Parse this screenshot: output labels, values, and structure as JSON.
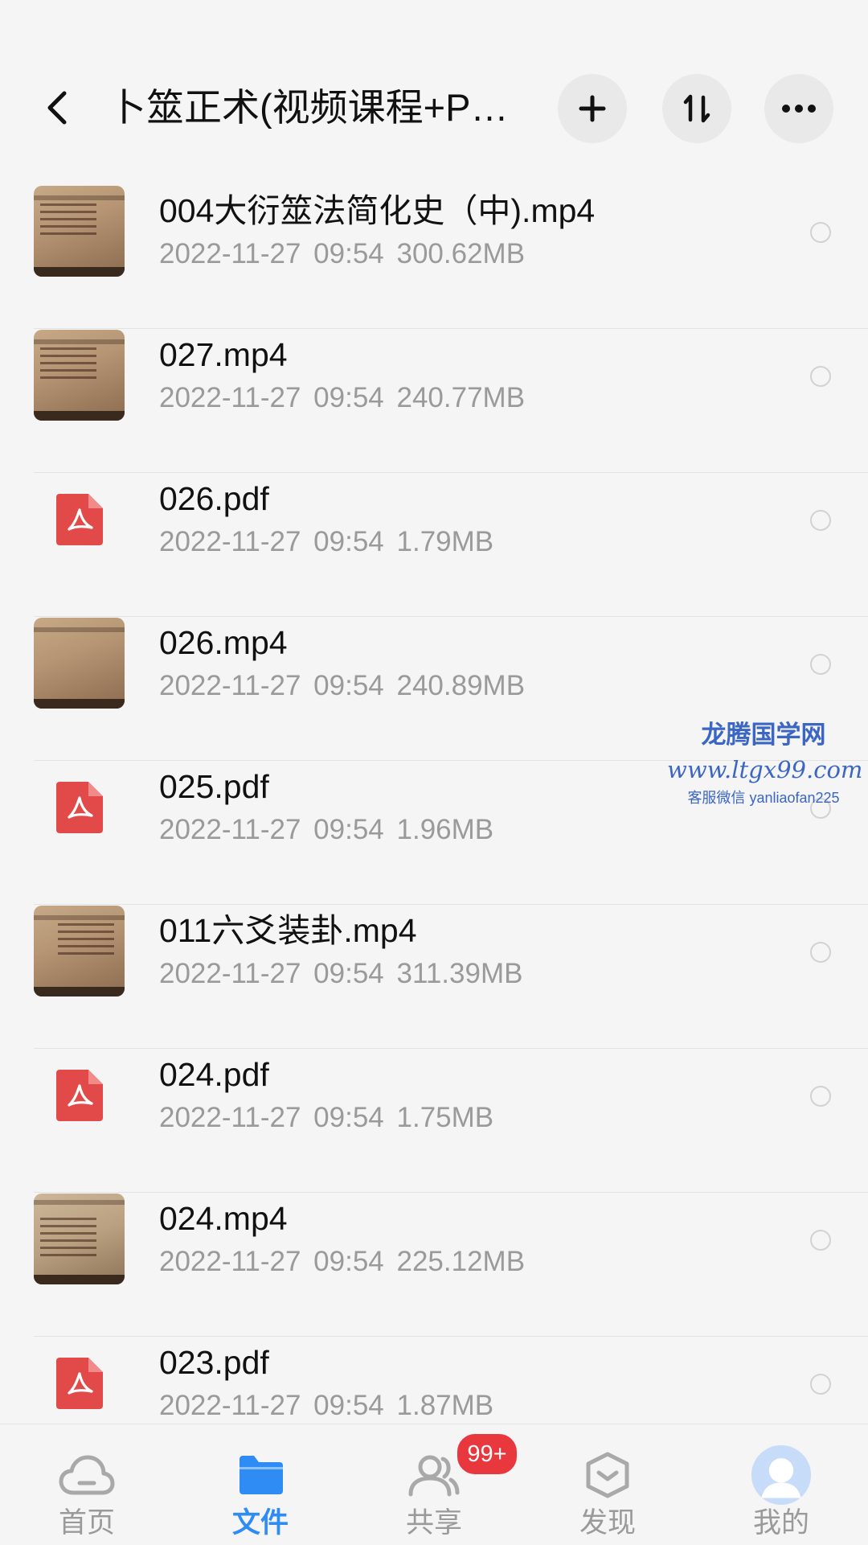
{
  "header": {
    "title": "卜筮正术(视频课程+PD...",
    "back_icon": "chevron-left-icon",
    "add_icon": "plus-icon",
    "sort_icon": "sort-icon",
    "more_icon": "more-horizontal-icon"
  },
  "files": [
    {
      "name": "004大衍筮法简化史（中).mp4",
      "date": "2022-11-27",
      "time": "09:54",
      "size": "300.62MB",
      "type": "video"
    },
    {
      "name": "027.mp4",
      "date": "2022-11-27",
      "time": "09:54",
      "size": "240.77MB",
      "type": "video"
    },
    {
      "name": "026.pdf",
      "date": "2022-11-27",
      "time": "09:54",
      "size": "1.79MB",
      "type": "pdf"
    },
    {
      "name": "026.mp4",
      "date": "2022-11-27",
      "time": "09:54",
      "size": "240.89MB",
      "type": "video"
    },
    {
      "name": "025.pdf",
      "date": "2022-11-27",
      "time": "09:54",
      "size": "1.96MB",
      "type": "pdf"
    },
    {
      "name": "011六爻装卦.mp4",
      "date": "2022-11-27",
      "time": "09:54",
      "size": "311.39MB",
      "type": "video"
    },
    {
      "name": "024.pdf",
      "date": "2022-11-27",
      "time": "09:54",
      "size": "1.75MB",
      "type": "pdf"
    },
    {
      "name": "024.mp4",
      "date": "2022-11-27",
      "time": "09:54",
      "size": "225.12MB",
      "type": "video"
    },
    {
      "name": "023.pdf",
      "date": "2022-11-27",
      "time": "09:54",
      "size": "1.87MB",
      "type": "pdf"
    }
  ],
  "watermark": {
    "line1": "龙腾国学网",
    "line2": "www.ltgx99.com",
    "line3": "客服微信 yanliaofan225"
  },
  "tabbar": {
    "tabs": [
      {
        "label": "首页",
        "icon": "cloud-icon"
      },
      {
        "label": "文件",
        "icon": "folder-icon"
      },
      {
        "label": "共享",
        "icon": "people-icon"
      },
      {
        "label": "发现",
        "icon": "discover-hexagon-icon"
      },
      {
        "label": "我的",
        "icon": "avatar-icon"
      }
    ],
    "share_badge": "99+",
    "active_index": 1
  },
  "colors": {
    "accent": "#2f8cf5",
    "pdf_red": "#e24a4a",
    "badge_red": "#e8383d",
    "watermark_blue": "#3b66c4"
  }
}
